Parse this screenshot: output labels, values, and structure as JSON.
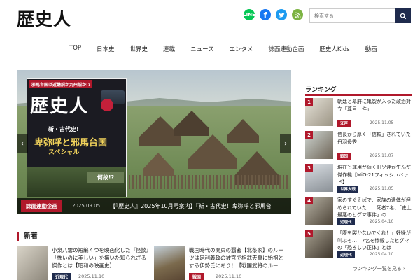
{
  "header": {
    "logo": "歴史人",
    "search_placeholder": "検索する",
    "social": [
      {
        "name": "line-icon",
        "glyph": "L",
        "color": "#06c755"
      },
      {
        "name": "facebook-icon",
        "glyph": "f",
        "color": "#1877f2"
      },
      {
        "name": "twitter-icon",
        "glyph": "t",
        "color": "#1d9bf0"
      },
      {
        "name": "rss-icon",
        "glyph": "r",
        "color": "#7cb342"
      }
    ]
  },
  "nav": [
    "TOP",
    "日本史",
    "世界史",
    "連載",
    "ニュース",
    "エンタメ",
    "誌面連動企画",
    "歴史人Kids",
    "動画"
  ],
  "hero": {
    "magazine": {
      "top_badge": "邪馬台国は近畿説か九州説か!?",
      "title": "歴史人",
      "subtitle": "新・古代史!",
      "headline": "卑弥呼と邪馬台国",
      "headline2": "スペシャル",
      "question": "何故!?"
    },
    "caption_category": "誌面連動企画",
    "caption_date": "2025.09.05",
    "caption_text": "【『歴史人』2025年10月号案内】『新・古代史！卑弥呼と邪馬台..."
  },
  "new_section": {
    "title": "新着",
    "items": [
      {
        "text": "小泉八雲の短編４つを映画化した『怪談』「怖いのに美しい」を描いた知られざる傑作とは【昭和の映画史】",
        "category": "近現代",
        "date": "2025.11.10"
      },
      {
        "text": "戦国時代の関東の覇者【北条家】のルーツは足利義政の被官で相武天皇に始祖とする伊勢氏にあり！【戦国武将のルー...",
        "category": "戦国",
        "date": "2025.11.10"
      }
    ]
  },
  "ranking": {
    "title": "ランキング",
    "items": [
      {
        "rank": "1",
        "text": "朝廷と幕府に亀裂が入った政治対立「尊号一件」",
        "category": "江戸",
        "date": "2025.11.05"
      },
      {
        "rank": "2",
        "text": "信長から厚く「信頼」されていた丹羽長秀",
        "category": "戦国",
        "date": "2025.11.07"
      },
      {
        "rank": "3",
        "text": "現在も運用が続く旧ソ連が生んだ傑作機【MiG-21フィッシュベッド】",
        "category": "世界大戦",
        "date": "2025.11.05"
      },
      {
        "rank": "4",
        "text": "家のすぐそばで、家族の遺体が埋められていた…　死者7名、「史上最悪のヒグマ事件」の...",
        "category": "近現代",
        "date": "2025.04.10"
      },
      {
        "rank": "5",
        "text": "「腹を裂かないでくれ！」妊婦が叫ぶも…　7名を惨殺したヒグマの「恐ろしい正体」とは",
        "category": "近現代",
        "date": "2025.04.10"
      }
    ],
    "more": "ランキング一覧を見る ›"
  }
}
